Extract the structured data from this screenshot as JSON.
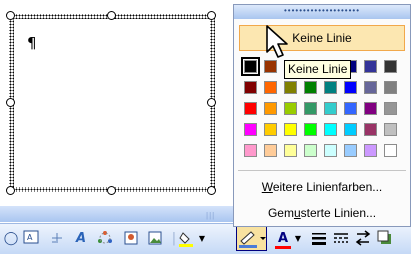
{
  "document": {
    "paragraph_mark": "¶",
    "strip_grip": "|||"
  },
  "popup": {
    "grip": "••••••••••••••••••••",
    "no_line_label": "Keine Linie",
    "tooltip": "Keine Linie",
    "more_colors_label": "Weitere Linienfarben...",
    "more_colors_access": "W",
    "more_colors_rest": "eitere Linienfarben...",
    "patterned_label": "Gemusterte Linien...",
    "patterned_before": "Gem",
    "patterned_access": "u",
    "patterned_after": "sterte Linien...",
    "colors": [
      [
        "#000000",
        "#993300",
        "#333300",
        "#003300",
        "#003366",
        "#000080",
        "#333399",
        "#333333"
      ],
      [
        "#800000",
        "#FF6600",
        "#808000",
        "#008000",
        "#008080",
        "#0000FF",
        "#666699",
        "#808080"
      ],
      [
        "#FF0000",
        "#FF9900",
        "#99CC00",
        "#339966",
        "#33CCCC",
        "#3366FF",
        "#800080",
        "#969696"
      ],
      [
        "#FF00FF",
        "#FFCC00",
        "#FFFF00",
        "#00FF00",
        "#00FFFF",
        "#00CCFF",
        "#993366",
        "#C0C0C0"
      ],
      [
        "#FF99CC",
        "#FFCC99",
        "#FFFF99",
        "#CCFFCC",
        "#CCFFFF",
        "#99CCFF",
        "#CC99FF",
        "#FFFFFF"
      ]
    ],
    "selected_color": "#000000"
  },
  "toolbar": {
    "line_color_accent": "#4a7bd8",
    "font_color_accent": "#ff0000"
  }
}
